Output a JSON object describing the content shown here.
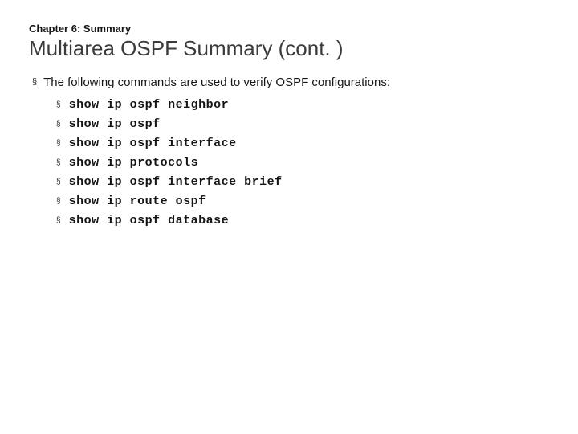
{
  "chapter_label": "Chapter 6: Summary",
  "title": "Multiarea OSPF Summary (cont. )",
  "intro": "The following commands are used to verify OSPF configurations:",
  "commands": [
    "show ip ospf neighbor",
    "show ip ospf",
    "show ip ospf interface",
    "show ip protocols",
    "show ip ospf interface brief",
    "show ip route ospf",
    "show ip ospf database"
  ]
}
